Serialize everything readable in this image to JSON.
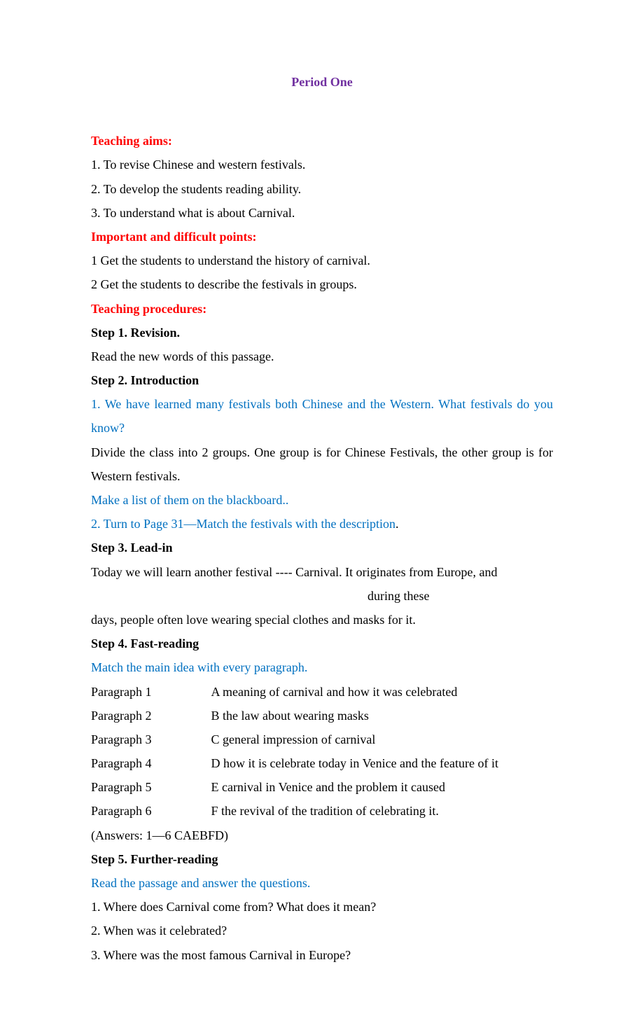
{
  "title": "Period One",
  "sections": {
    "teaching_aims": {
      "heading": "Teaching aims:",
      "items": [
        "1. To revise Chinese and western festivals.",
        "2. To develop the students reading ability.",
        "3. To understand what is about Carnival."
      ]
    },
    "important_points": {
      "heading": "Important and difficult points:",
      "items": [
        "1 Get the students to understand the history of carnival.",
        "2 Get the students to describe the festivals in groups."
      ]
    },
    "procedures": {
      "heading": "Teaching procedures:",
      "step1": {
        "heading": "Step 1. Revision.",
        "text": "Read the new words of this passage."
      },
      "step2": {
        "heading": "Step 2. Introduction",
        "q1": "1. We have learned many festivals both Chinese and the Western. What festivals do you know?",
        "text1": "Divide the class into 2 groups. One group is for Chinese Festivals, the other group is for Western festivals.",
        "note1": "Make a list of them on the blackboard..",
        "q2": "2. Turn to Page 31—Match the festivals with the description",
        "period": "."
      },
      "step3": {
        "heading": "Step 3. Lead-in",
        "text1": "Today we will learn another festival ---- Carnival. It originates from Europe, and",
        "text2": "during these",
        "text3": "days, people often love wearing special clothes and masks for it."
      },
      "step4": {
        "heading": "Step 4. Fast-reading",
        "note": "Match the main idea with every paragraph.",
        "matches": [
          {
            "left": "Paragraph 1",
            "right": "A meaning of carnival and how it was celebrated"
          },
          {
            "left": "Paragraph 2",
            "right": "B the law about wearing masks"
          },
          {
            "left": "Paragraph 3",
            "right": "C general impression of carnival"
          },
          {
            "left": "Paragraph 4",
            "right": "D how it is celebrate today in Venice and the feature of it"
          },
          {
            "left": "Paragraph 5",
            "right": "E carnival in Venice and the problem it caused"
          },
          {
            "left": "Paragraph 6",
            "right": "F the revival of the tradition of celebrating it."
          }
        ],
        "answers": "(Answers: 1—6 CAEBFD)"
      },
      "step5": {
        "heading": "Step 5. Further-reading",
        "note": "Read the passage and answer the questions.",
        "questions": [
          "1. Where does Carnival come from? What does it mean?",
          "2. When was it celebrated?",
          "3. Where was the most famous Carnival in Europe?"
        ]
      }
    }
  }
}
